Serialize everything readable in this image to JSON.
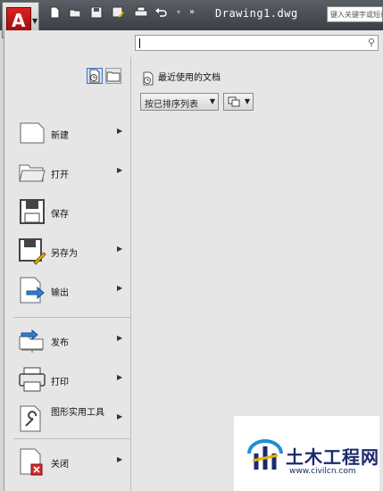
{
  "title_bar": {
    "document_title": "Drawing1.dwg",
    "search_placeholder": "键入关键字或短语",
    "quick_access_icons": [
      "new-icon",
      "open-icon",
      "save-icon",
      "save-as-icon",
      "print-icon",
      "undo-icon",
      "overflow-icon"
    ]
  },
  "app_menu": {
    "search_value": "",
    "view_toggles": [
      "recent-documents-icon",
      "open-documents-icon"
    ],
    "items": [
      {
        "label": "新建",
        "icon": "new-document-icon",
        "has_submenu": true
      },
      {
        "label": "打开",
        "icon": "open-folder-icon",
        "has_submenu": true
      },
      {
        "label": "保存",
        "icon": "save-icon",
        "has_submenu": false
      },
      {
        "label": "另存为",
        "icon": "save-as-icon",
        "has_submenu": true
      },
      {
        "label": "输出",
        "icon": "export-icon",
        "has_submenu": true
      },
      {
        "label": "发布",
        "icon": "publish-icon",
        "has_submenu": true
      },
      {
        "label": "打印",
        "icon": "printer-icon",
        "has_submenu": true
      },
      {
        "label": "图形实用工具",
        "icon": "drawing-utilities-icon",
        "has_submenu": true
      },
      {
        "label": "关闭",
        "icon": "close-document-icon",
        "has_submenu": true
      }
    ],
    "recent": {
      "title": "最近使用的文档",
      "sort_value": "按已排序列表",
      "view_icon": "icon-view-icon"
    }
  },
  "watermark": {
    "text": "土木工程网",
    "url": "www.civilcn.com"
  },
  "colors": {
    "title_bar": "#3b3f45",
    "panel": "#e6e6e6",
    "accent": "#3a74c4",
    "logo_red": "#c41616",
    "watermark_blue": "#1a2a6e"
  }
}
